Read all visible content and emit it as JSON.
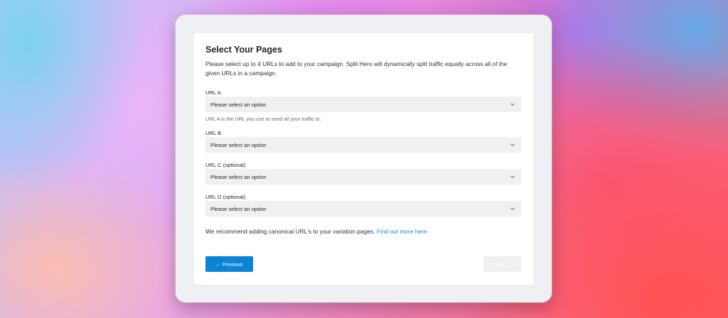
{
  "wizard": {
    "title": "Select Your Pages",
    "description": "Please select up to 4 URLs to add to your campaign. Split Hero will dynamically split traffic equally across all of the given URLs in a campaign.",
    "fields": [
      {
        "label": "URL A",
        "value": "Please select an option",
        "help": "URL A is the URL you use to send all your traffic to."
      },
      {
        "label": "URL B",
        "value": "Please select an option"
      },
      {
        "label": "URL C (optional)",
        "value": "Please select an option"
      },
      {
        "label": "URL D (optional)",
        "value": "Please select an option"
      }
    ],
    "recommendation": {
      "text": "We recommend adding canonical URL's to your variation pages.",
      "link_text": "Find out more here."
    },
    "buttons": {
      "previous": "← Previous",
      "next": "Next →"
    }
  },
  "colors": {
    "primary_button": "#0a84d6",
    "link": "#1a8ad1",
    "select_background": "#f0f0f1",
    "disabled_button": "#f0f0f1"
  },
  "icons": {
    "select_chevron": "chevron-down-icon"
  }
}
